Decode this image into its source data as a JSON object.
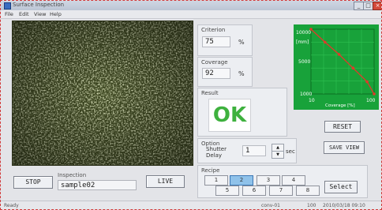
{
  "window": {
    "title": "Surface Inspection"
  },
  "menu": [
    "File",
    "Edit",
    "View",
    "Help"
  ],
  "camera": {
    "stop_label": "STOP",
    "live_label": "LIVE",
    "inspect_label": "Inspection",
    "inspect_value": "sample02"
  },
  "criterion": {
    "title": "Criterion",
    "value": "75",
    "unit": "%"
  },
  "coverage": {
    "title": "Coverage",
    "value": "92",
    "unit": "%"
  },
  "result": {
    "title": "Result",
    "value": "OK"
  },
  "option": {
    "title": "Option",
    "shutter_label_1": "Shutter",
    "shutter_label_2": "Delay",
    "shutter_value": "1",
    "shutter_unit": "sec"
  },
  "graph": {
    "y_top": "10000",
    "y_unit": "[mm]",
    "y_mid": "5000",
    "y_bottom": "1000",
    "x_left": "10",
    "x_mid": "Coverage [%]",
    "x_right": "100",
    "line_color": "#e03a2a",
    "bg_color": "#18a23a",
    "points": [
      [
        10,
        10000
      ],
      [
        30,
        8200
      ],
      [
        50,
        6500
      ],
      [
        70,
        4600
      ],
      [
        90,
        2700
      ],
      [
        100,
        1000
      ]
    ]
  },
  "buttons": {
    "reset": "RESET",
    "save_view": "SAVE VIEW",
    "select": "Select"
  },
  "recipe": {
    "title": "Recipe",
    "items": [
      "1",
      "2",
      "3",
      "4",
      "5",
      "6",
      "7",
      "8"
    ],
    "active": "2"
  },
  "status": {
    "left": "Ready",
    "mid1": "conv-01",
    "mid2": "100",
    "right": "2010/03/18 09:10"
  }
}
